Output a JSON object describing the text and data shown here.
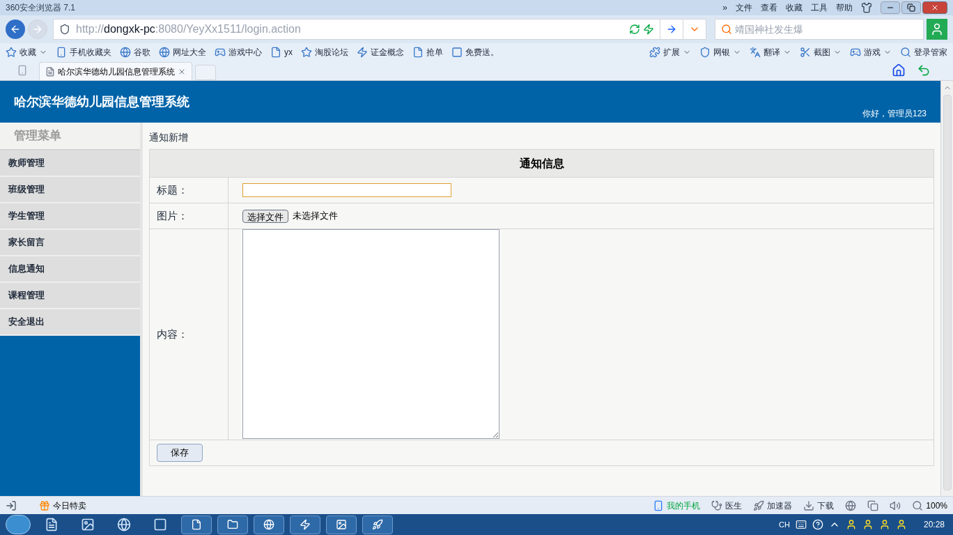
{
  "browser": {
    "title": "360安全浏览器 7.1",
    "menu": [
      "»",
      "文件",
      "查看",
      "收藏",
      "工具",
      "帮助"
    ],
    "address": {
      "scheme": "http://",
      "host": "dongxk-pc",
      "rest": ":8080/YeyXx1511/login.action"
    },
    "search": {
      "placeholder": "靖国神社发生爆"
    },
    "bookmarks": [
      {
        "label": "收藏",
        "dropdown": true
      },
      {
        "label": "手机收藏夹",
        "dropdown": false
      },
      {
        "label": "谷歌",
        "dropdown": false
      },
      {
        "label": "网址大全",
        "dropdown": false
      },
      {
        "label": "游戏中心",
        "dropdown": false
      },
      {
        "label": "yx",
        "dropdown": false
      },
      {
        "label": "淘股论坛",
        "dropdown": false
      },
      {
        "label": "证金概念",
        "dropdown": false
      },
      {
        "label": "抢单",
        "dropdown": false
      },
      {
        "label": "免费送。",
        "dropdown": false
      }
    ],
    "tools": [
      {
        "label": "扩展",
        "dropdown": true
      },
      {
        "label": "网银",
        "dropdown": true
      },
      {
        "label": "翻译",
        "dropdown": true
      },
      {
        "label": "截图",
        "dropdown": true
      },
      {
        "label": "游戏",
        "dropdown": true
      },
      {
        "label": "登录管家",
        "dropdown": false
      }
    ],
    "tabs": [
      {
        "label": "哈尔滨华德幼儿园信息管理系统",
        "selected": true
      }
    ]
  },
  "page": {
    "site_title": "哈尔滨华德幼儿园信息管理系统",
    "greeting": "你好，管理员123",
    "menu_heading": "管理菜单",
    "menu": [
      {
        "label": "教师管理"
      },
      {
        "label": "班级管理"
      },
      {
        "label": "学生管理"
      },
      {
        "label": "家长留言"
      },
      {
        "label": "信息通知"
      },
      {
        "label": "课程管理"
      },
      {
        "label": "安全退出"
      }
    ],
    "breadcrumb": "通知新增",
    "form": {
      "heading": "通知信息",
      "fields": [
        {
          "kind": "text",
          "label": "标题：",
          "focused": true
        },
        {
          "kind": "file",
          "label": "图片：",
          "button": "选择文件",
          "status": "未选择文件"
        },
        {
          "kind": "textarea",
          "label": "内容："
        }
      ],
      "save": "保存"
    }
  },
  "status_bar": {
    "left": [
      "今日特卖"
    ],
    "right": [
      {
        "label": "我的手机",
        "highlight": true
      },
      {
        "label": "医生",
        "highlight": false
      },
      {
        "label": "加速器",
        "highlight": false
      },
      {
        "label": "下载",
        "highlight": false
      }
    ],
    "zoom": "100%"
  },
  "taskbar": {
    "lang": "CH",
    "time": "20:28"
  }
}
